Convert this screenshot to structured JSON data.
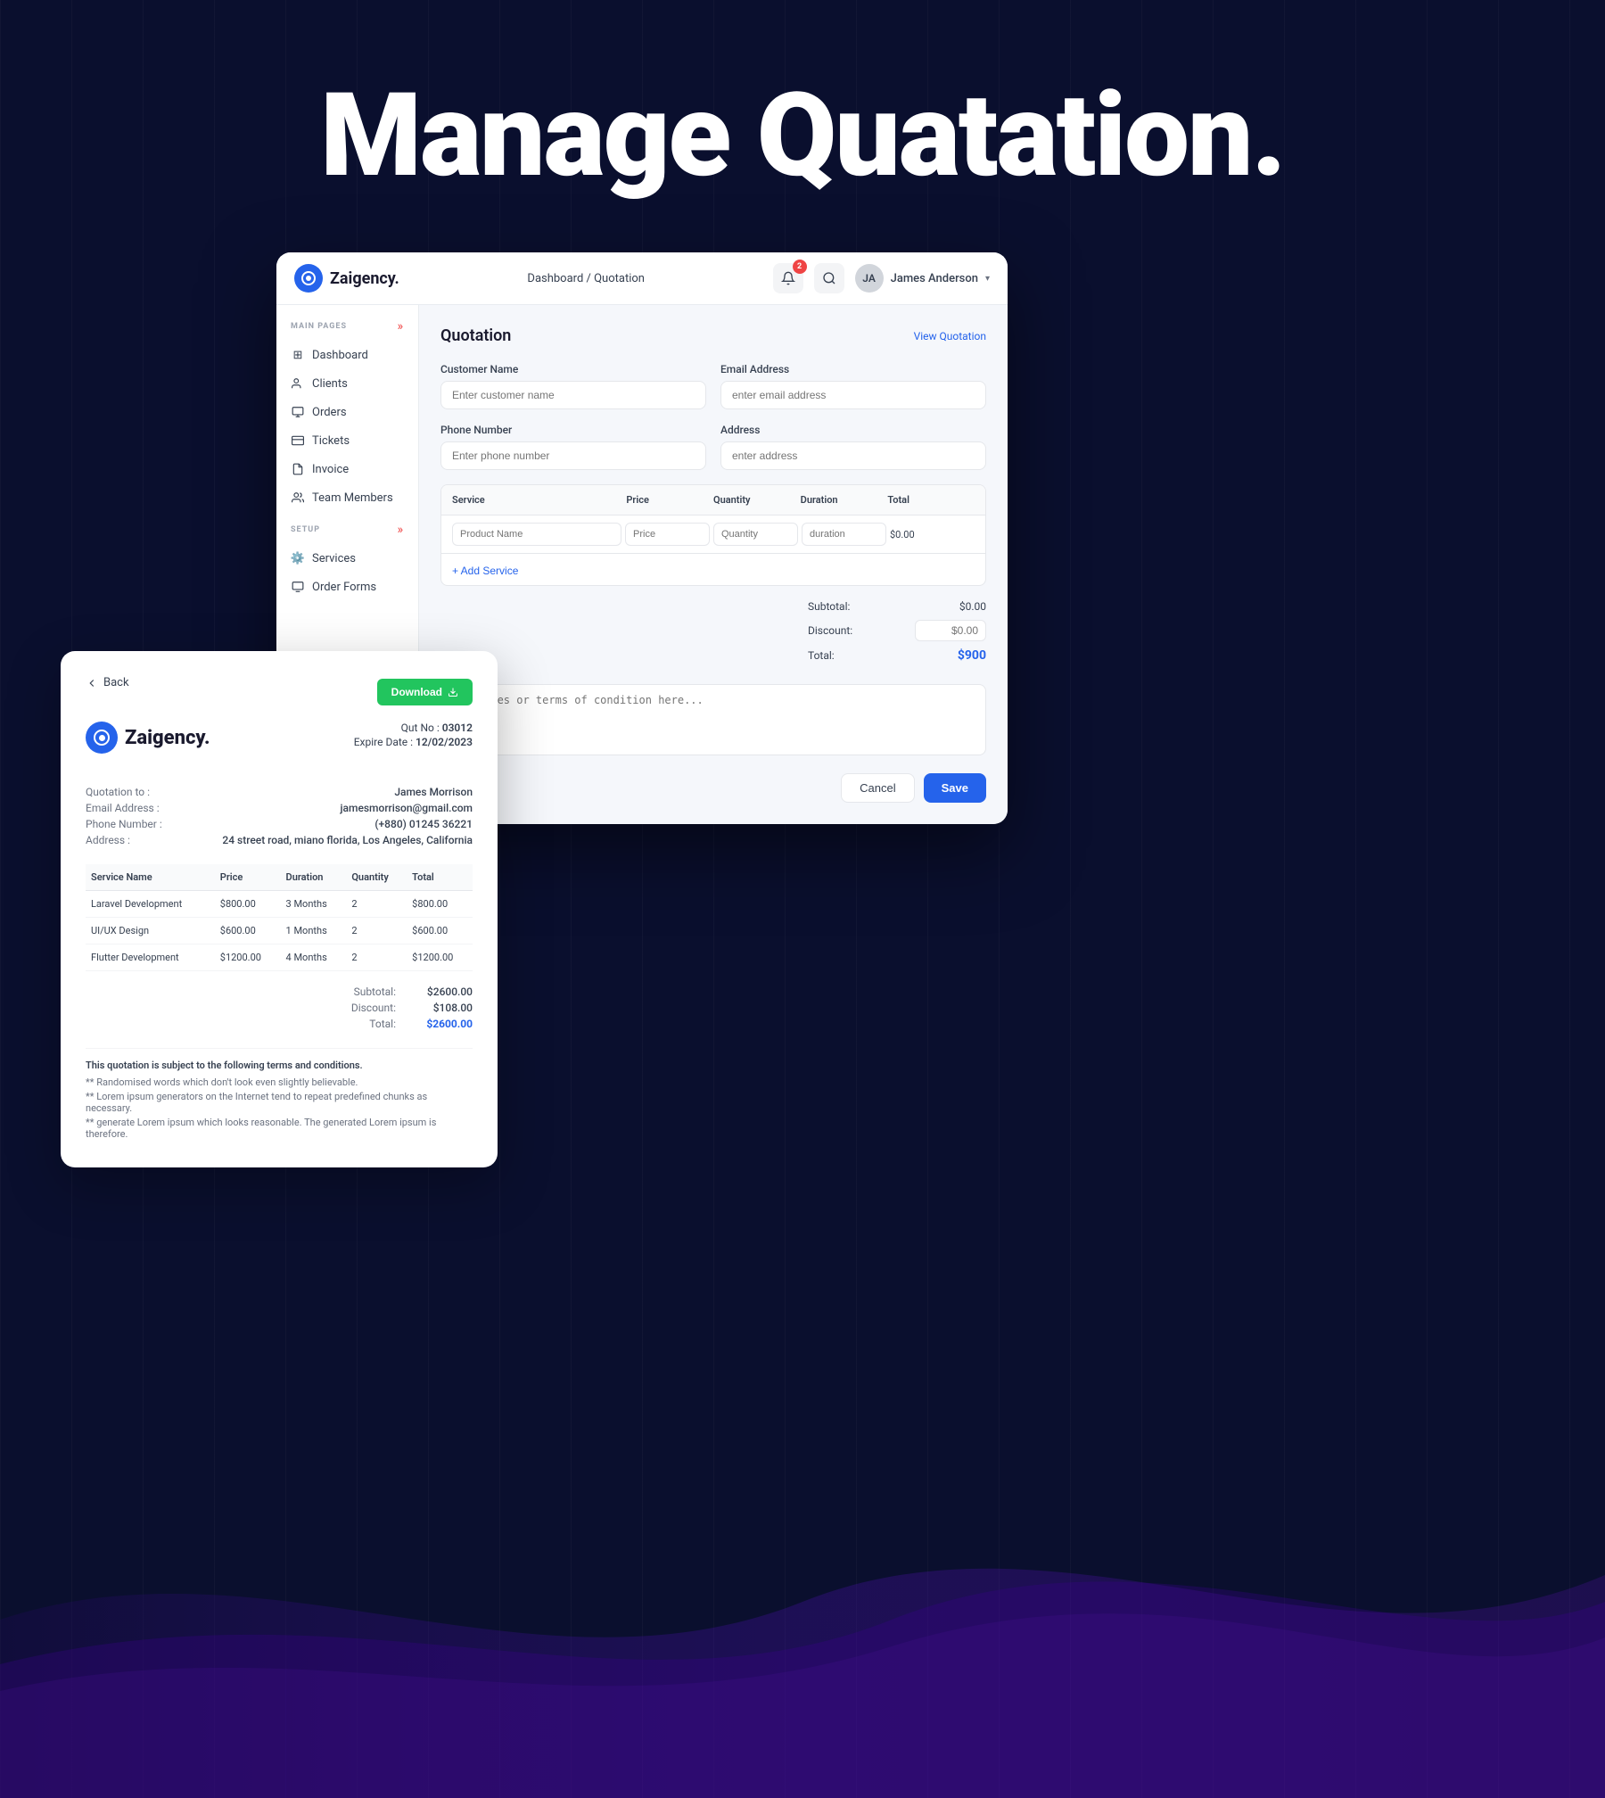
{
  "page": {
    "background_title": "Manage Quatation.",
    "bg_color": "#0a0f2e"
  },
  "app": {
    "logo": {
      "text": "Zaigency.",
      "icon_label": "zaigency-logo"
    },
    "breadcrumb": {
      "home": "Dashboard",
      "separator": " / ",
      "current": "Quotation"
    },
    "header": {
      "notification_count": "2",
      "user_name": "James Anderson",
      "chevron": "▾"
    },
    "sidebar": {
      "main_label": "MAIN PAGES",
      "expand_icon": "»",
      "items": [
        {
          "label": "Dashboard",
          "icon": "⊞",
          "active": false
        },
        {
          "label": "Clients",
          "icon": "👤",
          "active": false
        },
        {
          "label": "Orders",
          "icon": "📋",
          "active": false
        },
        {
          "label": "Tickets",
          "icon": "🎫",
          "active": false
        },
        {
          "label": "Invoice",
          "icon": "🧾",
          "active": false
        },
        {
          "label": "Team Members",
          "icon": "👥",
          "active": false
        }
      ],
      "setup_label": "SETUP",
      "setup_items": [
        {
          "label": "Services",
          "icon": "⚙️"
        },
        {
          "label": "Order Forms",
          "icon": "📄"
        }
      ]
    },
    "main": {
      "page_title": "Quotation",
      "view_quotation_link": "View Quotation",
      "form": {
        "customer_name_label": "Customer Name",
        "customer_name_placeholder": "Enter customer name",
        "email_label": "Email Address",
        "email_placeholder": "enter email address",
        "phone_label": "Phone Number",
        "phone_placeholder": "Enter phone number",
        "address_label": "Address",
        "address_placeholder": "enter address",
        "service_table": {
          "columns": [
            "Service",
            "Price",
            "Quantity",
            "Duration",
            "Total"
          ],
          "row_placeholders": {
            "product": "Product Name",
            "price": "Price",
            "quantity": "Quantity",
            "duration": "duration",
            "total": "$0.00"
          },
          "add_service_label": "+ Add Service"
        },
        "summary": {
          "subtotal_label": "Subtotal:",
          "subtotal_value": "$0.00",
          "discount_label": "Discount:",
          "discount_value": "$0.00",
          "total_label": "Total:",
          "total_value": "$900"
        },
        "notes_placeholder": "Add notes or terms of condition here...",
        "cancel_label": "Cancel",
        "save_label": "Save"
      }
    }
  },
  "quotation_card": {
    "back_label": "Back",
    "download_label": "Download",
    "logo_text": "Zaigency.",
    "quot_no_label": "Qut No :",
    "quot_no_value": "03012",
    "expire_label": "Expire Date :",
    "expire_value": "12/02/2023",
    "info": {
      "to_label": "Quotation to :",
      "to_value": "James Morrison",
      "email_label": "Email Address :",
      "email_value": "jamesmorrison@gmail.com",
      "phone_label": "Phone Number :",
      "phone_value": "(+880) 01245 36221",
      "address_label": "Address :",
      "address_value": "24 street road, miano florida, Los Angeles, California"
    },
    "table": {
      "columns": [
        "Service Name",
        "Price",
        "Duration",
        "Quantity",
        "Total"
      ],
      "rows": [
        {
          "service": "Laravel Development",
          "price": "$800.00",
          "duration": "3 Months",
          "quantity": "2",
          "total": "$800.00"
        },
        {
          "service": "UI/UX Design",
          "price": "$600.00",
          "duration": "1 Months",
          "quantity": "2",
          "total": "$600.00"
        },
        {
          "service": "Flutter Development",
          "price": "$1200.00",
          "duration": "4 Months",
          "quantity": "2",
          "total": "$1200.00"
        }
      ]
    },
    "totals": {
      "subtotal_label": "Subtotal:",
      "subtotal_value": "$2600.00",
      "discount_label": "Discount:",
      "discount_value": "$108.00",
      "total_label": "Total:",
      "total_value": "$2600.00"
    },
    "terms": {
      "heading": "This quotation is subject to the following terms and conditions.",
      "lines": [
        "** Randomised words which don't look even slightly believable.",
        "** Lorem ipsum generators on the Internet tend to repeat predefined chunks as necessary.",
        "** generate Lorem ipsum which looks reasonable. The generated Lorem ipsum is therefore."
      ]
    }
  }
}
